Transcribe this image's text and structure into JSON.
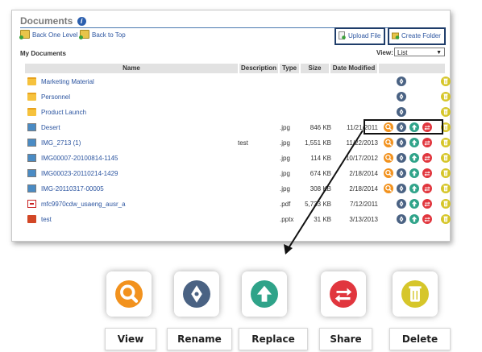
{
  "panel": {
    "title": "Documents",
    "info_icon": "info-icon",
    "back_one_level": "Back One Level",
    "back_to_top": "Back to Top",
    "upload_file": "Upload File",
    "create_folder": "Create Folder",
    "section_title": "My Documents",
    "view_label": "View:",
    "view_value": "List"
  },
  "table": {
    "headers": [
      "Name",
      "Description",
      "Type",
      "Size",
      "Date Modified"
    ],
    "rows": [
      {
        "name": "Marketing Material",
        "description": "",
        "type": "",
        "size": "",
        "date": "",
        "icon": "folder-icon",
        "actions": [
          "rename",
          "delete"
        ]
      },
      {
        "name": "Personnel",
        "description": "",
        "type": "",
        "size": "",
        "date": "",
        "icon": "folder-icon",
        "actions": [
          "rename",
          "delete"
        ]
      },
      {
        "name": "Product Launch",
        "description": "",
        "type": "",
        "size": "",
        "date": "",
        "icon": "folder-icon",
        "actions": [
          "rename",
          "delete"
        ]
      },
      {
        "name": "Desert",
        "description": "",
        "type": ".jpg",
        "size": "846 KB",
        "date": "11/21/2011",
        "icon": "image-file-icon",
        "actions": [
          "view",
          "rename",
          "replace",
          "share",
          "delete"
        ]
      },
      {
        "name": "IMG_2713 (1)",
        "description": "test",
        "type": ".jpg",
        "size": "1,551 KB",
        "date": "11/22/2013",
        "icon": "image-file-icon",
        "actions": [
          "view",
          "rename",
          "replace",
          "share",
          "delete"
        ]
      },
      {
        "name": "IMG00007-20100814-1145",
        "description": "",
        "type": ".jpg",
        "size": "114 KB",
        "date": "10/17/2012",
        "icon": "image-file-icon",
        "actions": [
          "view",
          "rename",
          "replace",
          "share",
          "delete"
        ]
      },
      {
        "name": "IMG00023-20110214-1429",
        "description": "",
        "type": ".jpg",
        "size": "674 KB",
        "date": "2/18/2014",
        "icon": "image-file-icon",
        "actions": [
          "view",
          "rename",
          "replace",
          "share",
          "delete"
        ]
      },
      {
        "name": "IMG-20110317-00005",
        "description": "",
        "type": ".jpg",
        "size": "308 KB",
        "date": "2/18/2014",
        "icon": "image-file-icon",
        "actions": [
          "view",
          "rename",
          "replace",
          "share",
          "delete"
        ]
      },
      {
        "name": "mfc9970cdw_usaeng_ausr_a",
        "description": "",
        "type": ".pdf",
        "size": "5,733 KB",
        "date": "7/12/2011",
        "icon": "pdf-file-icon",
        "actions": [
          "rename",
          "replace",
          "share",
          "delete"
        ]
      },
      {
        "name": "test",
        "description": "",
        "type": ".pptx",
        "size": "31 KB",
        "date": "3/13/2013",
        "icon": "pptx-file-icon",
        "actions": [
          "rename",
          "replace",
          "share",
          "delete"
        ]
      }
    ]
  },
  "legend": {
    "items": [
      {
        "key": "view",
        "label": "View",
        "icon": "magnifier-icon",
        "color": "#f2921e"
      },
      {
        "key": "rename",
        "label": "Rename",
        "icon": "pen-nib-icon",
        "color": "#4a6283"
      },
      {
        "key": "replace",
        "label": "Replace",
        "icon": "arrow-up-icon",
        "color": "#2fa389"
      },
      {
        "key": "share",
        "label": "Share",
        "icon": "share-arrows-icon",
        "color": "#e1363e"
      },
      {
        "key": "delete",
        "label": "Delete",
        "icon": "trash-icon",
        "color": "#d6c62a"
      }
    ]
  },
  "colors": {
    "link": "#2c55a0",
    "header_bg": "#e2e2e2",
    "highlight_border": "#1f3d6a"
  }
}
